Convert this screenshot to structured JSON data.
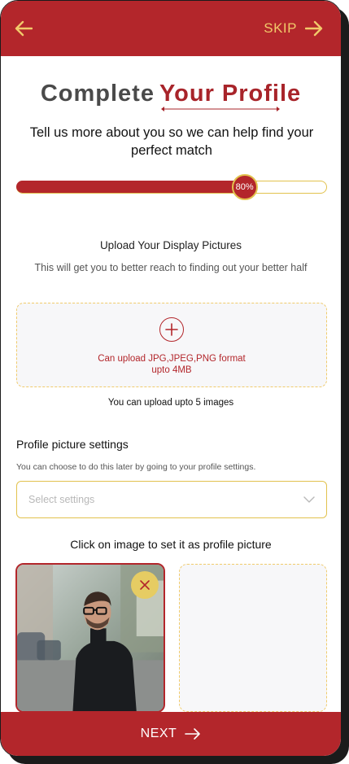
{
  "header": {
    "skip_label": "SKIP",
    "back_icon": "arrow-left-icon",
    "skip_icon": "arrow-right-icon"
  },
  "title": {
    "part1": "Complete",
    "part2": "Your Profile"
  },
  "subtitle": "Tell us more about you so we can help find your perfect match",
  "progress": {
    "percent": 80,
    "label": "80%"
  },
  "upload": {
    "heading": "Upload Your Display Pictures",
    "subheading": "This will get you to better reach to finding out your better half",
    "dropzone_line1": "Can upload JPG,JPEG,PNG format",
    "dropzone_line2": "upto 4MB",
    "limit_text": "You can upload upto 5 images"
  },
  "profile_settings": {
    "heading": "Profile picture settings",
    "subheading": "You can choose to do this later by going to your profile settings.",
    "select_placeholder": "Select settings"
  },
  "images": {
    "hint": "Click on image to set it as profile picture"
  },
  "footer": {
    "next_label": "NEXT"
  },
  "colors": {
    "primary": "#b3262b",
    "accent": "#e2c24e",
    "skip": "#f1c96a"
  }
}
